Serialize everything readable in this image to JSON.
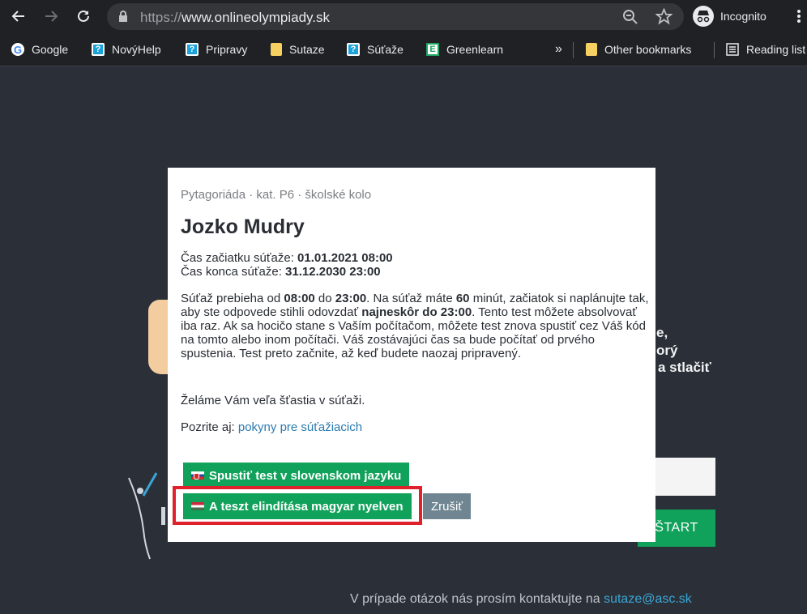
{
  "browser": {
    "url_proto": "https://",
    "url_host": "www.onlineolympiady.sk",
    "incognito_label": "Incognito",
    "bookmarks": [
      {
        "label": "Google",
        "icon": "google-icon"
      },
      {
        "label": "NovýHelp",
        "icon": "help-icon"
      },
      {
        "label": "Pripravy",
        "icon": "help-icon"
      },
      {
        "label": "Sutaze",
        "icon": "folder-icon"
      },
      {
        "label": "Súťaže",
        "icon": "help-icon"
      },
      {
        "label": "Greenlearn",
        "icon": "greenlearn-icon"
      }
    ],
    "overflow": "»",
    "other_bookmarks": "Other bookmarks",
    "reading_list": "Reading list"
  },
  "background": {
    "fragment1": "e,",
    "fragment2": "orý",
    "fragment3": "a stlačiť",
    "start_label": "ŠTART",
    "footer_text": "V prípade otázok nás prosím kontaktujte na ",
    "footer_email": "sutaze@asc.sk"
  },
  "modal": {
    "breadcrumb": "Pytagoriáda · kat. P6 · školské kolo",
    "title": "Jozko Mudry",
    "start_label": "Čas začiatku súťaže: ",
    "start_value": "01.01.2021 08:00",
    "end_label": "Čas konca súťaže: ",
    "end_value": "31.12.2030 23:00",
    "para": {
      "p1": "Súťaž prebieha od ",
      "from": "08:00",
      "p2": " do ",
      "to": "23:00",
      "p3": ". Na súťaž máte ",
      "minutes": "60",
      "p4": " minút, začiatok si naplánujte tak, aby ste odpovede stihli odovzdať ",
      "deadline": "najneskôr do 23:00",
      "p5": ". Tento test môžete absolvovať iba raz. Ak sa hocičo stane s Vaším počítačom, môžete test znova spustiť cez Váš kód na tomto alebo inom počítači. Váš zostávajúci čas sa bude počítať od prvého spustenia. Test preto začnite, až keď budete naozaj pripravený."
    },
    "wish": "Želáme Vám veľa šťastia v súťaži.",
    "see_label": "Pozrite aj: ",
    "see_link": "pokyny pre súťažiacich",
    "btn_sk": "Spustiť test v slovenskom jazyku",
    "btn_hu": "A teszt elindítása magyar nyelven",
    "btn_cancel": "Zrušiť"
  },
  "colors": {
    "accent_green": "#10a15a",
    "highlight_red": "#e0202a",
    "link_blue": "#2a7ab0"
  }
}
